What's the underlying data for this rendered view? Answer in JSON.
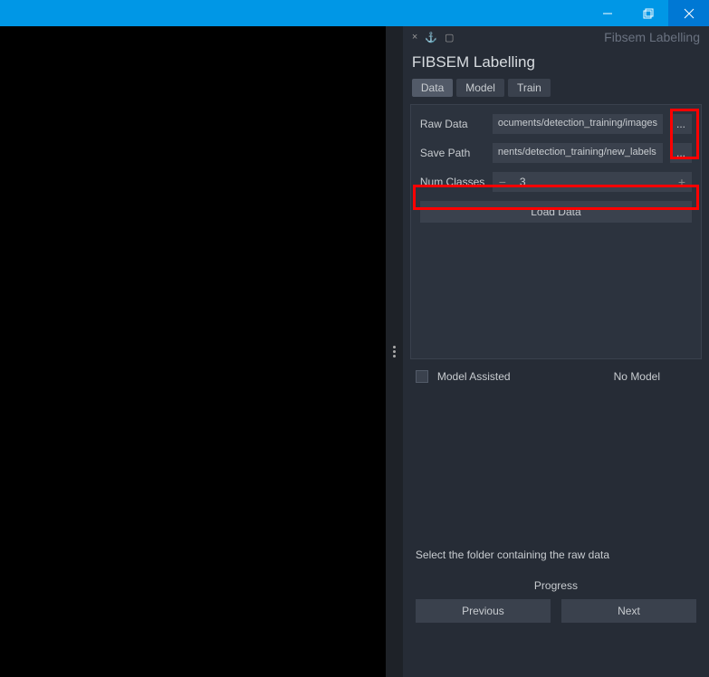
{
  "window": {
    "header_title": "Fibsem Labelling"
  },
  "panel": {
    "title": "FIBSEM Labelling",
    "tabs": [
      "Data",
      "Model",
      "Train"
    ],
    "active_tab": 0
  },
  "form": {
    "raw_data_label": "Raw Data",
    "raw_data_value": "ocuments/detection_training/images",
    "save_path_label": "Save Path",
    "save_path_value": "nents/detection_training/new_labels",
    "num_classes_label": "Num Classes",
    "num_classes_value": "3",
    "browse_label": "...",
    "load_button": "Load Data"
  },
  "model": {
    "assisted_label": "Model Assisted",
    "status": "No Model"
  },
  "footer": {
    "hint": "Select the folder containing the raw data",
    "progress_label": "Progress",
    "prev_button": "Previous",
    "next_button": "Next"
  }
}
